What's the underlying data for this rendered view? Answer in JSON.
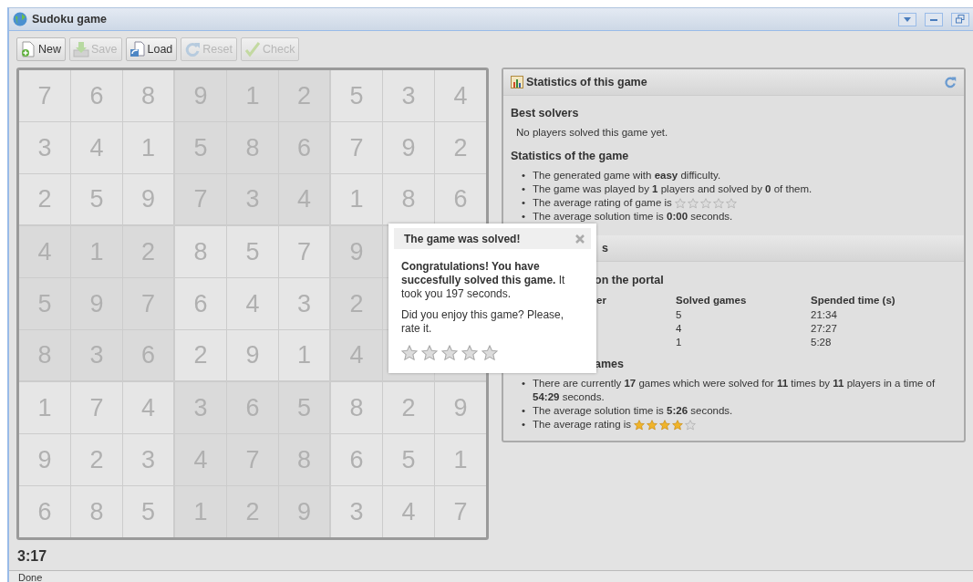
{
  "window": {
    "title": "Sudoku game"
  },
  "toolbar": [
    {
      "kind": "new",
      "label": "New",
      "disabled": false
    },
    {
      "kind": "save",
      "label": "Save",
      "disabled": true
    },
    {
      "kind": "load",
      "label": "Load",
      "disabled": false
    },
    {
      "kind": "reset",
      "label": "Reset",
      "disabled": true
    },
    {
      "kind": "check",
      "label": "Check",
      "disabled": true
    }
  ],
  "board": [
    [
      "7",
      "6",
      "8",
      "9",
      "1",
      "2",
      "5",
      "3",
      "4"
    ],
    [
      "3",
      "4",
      "1",
      "5",
      "8",
      "6",
      "7",
      "9",
      "2"
    ],
    [
      "2",
      "5",
      "9",
      "7",
      "3",
      "4",
      "1",
      "8",
      "6"
    ],
    [
      "4",
      "1",
      "2",
      "8",
      "5",
      "7",
      "9"
    ],
    [
      "5",
      "9",
      "7",
      "6",
      "4",
      "3",
      "2"
    ],
    [
      "8",
      "3",
      "6",
      "2",
      "9",
      "1",
      "4"
    ],
    [
      "1",
      "7",
      "4",
      "3",
      "6",
      "5",
      "8",
      "2",
      "9"
    ],
    [
      "9",
      "2",
      "3",
      "4",
      "7",
      "8",
      "6",
      "5",
      "1"
    ],
    [
      "6",
      "8",
      "5",
      "1",
      "2",
      "9",
      "3",
      "4",
      "7"
    ]
  ],
  "timer": "3:17",
  "game_stats": {
    "title": "Statistics of this game",
    "best_solvers_heading": "Best solvers",
    "best_solvers_text": "No players solved this game yet.",
    "stats_heading": "Statistics of the game",
    "items": [
      {
        "kind": "text",
        "bullet": "•",
        "text": "The generated game with **easy** difficulty."
      },
      {
        "kind": "text",
        "bullet": "•",
        "text": "The game was played by **1** players and solved by **0** of them."
      },
      {
        "kind": "rating",
        "bullet": "•",
        "text": "The average rating of game is",
        "stars": 0
      },
      {
        "kind": "text",
        "bullet": "•",
        "text": "The average solution time is **0:00** seconds."
      }
    ]
  },
  "portal_stats": {
    "title": "s",
    "heading": "on the portal",
    "columns": [
      "er",
      "Solved games",
      "Spended time (s)"
    ],
    "rows": [
      [
        "",
        "5",
        "21:34"
      ],
      [
        "",
        "4",
        "27:27"
      ],
      [
        "",
        "1",
        "5:28"
      ]
    ],
    "games_heading": "ames",
    "items": [
      {
        "kind": "text",
        "bullet": "•",
        "text": "There are currently **17** games which were solved for **11** times by **11** players in a time of **54:29** seconds."
      },
      {
        "kind": "text",
        "bullet": "•",
        "text": "The average solution time is **5:26** seconds."
      },
      {
        "kind": "rating",
        "bullet": "•",
        "text": "The average rating is",
        "stars": 4
      }
    ]
  },
  "dialog": {
    "title": "The game was solved!",
    "message": "**Congratulations! You have succesfully solved this game.** It took you 197 seconds.",
    "question": "Did you enjoy this game? Please, rate it.",
    "stars": 0
  },
  "status_bar": "Done"
}
